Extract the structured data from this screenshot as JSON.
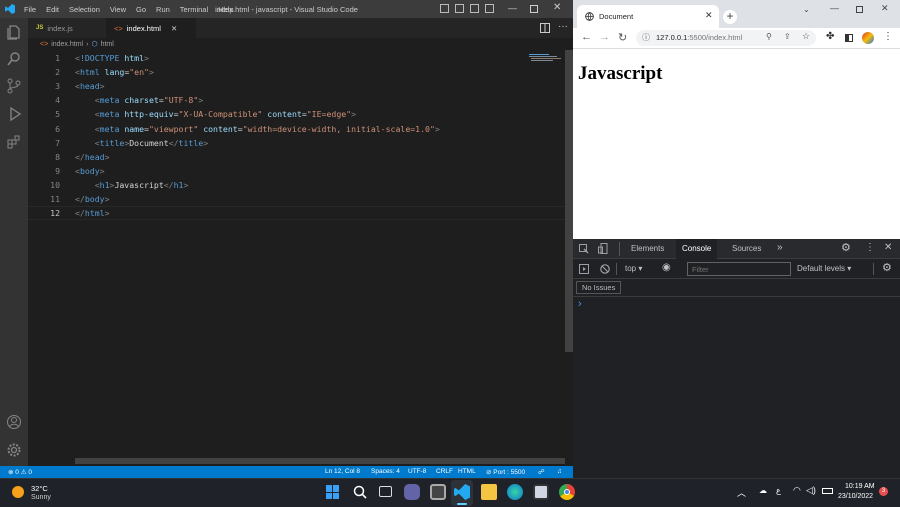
{
  "vscode": {
    "menu": [
      "File",
      "Edit",
      "Selection",
      "View",
      "Go",
      "Run",
      "Terminal",
      "Help"
    ],
    "window_title": "index.html - javascript - Visual Studio Code",
    "tabs": [
      {
        "badge": "JS",
        "label": "index.js",
        "active": false
      },
      {
        "badge": "",
        "label": "index.html",
        "active": true
      }
    ],
    "breadcrumb": [
      "index.html",
      "html"
    ],
    "lines": [
      {
        "n": "1",
        "html": "<span class='br'>&lt;</span><span class='tg'>!DOCTYPE</span> <span class='at'>html</span><span class='br'>&gt;</span>"
      },
      {
        "n": "2",
        "html": "<span class='br'>&lt;</span><span class='tg'>html</span> <span class='at'>lang</span>=<span class='st'>\"en\"</span><span class='br'>&gt;</span>"
      },
      {
        "n": "3",
        "html": "<span class='br'>&lt;</span><span class='tg'>head</span><span class='br'>&gt;</span>"
      },
      {
        "n": "4",
        "html": "    <span class='br'>&lt;</span><span class='tg'>meta</span> <span class='at'>charset</span>=<span class='st'>\"UTF-8\"</span><span class='br'>&gt;</span>"
      },
      {
        "n": "5",
        "html": "    <span class='br'>&lt;</span><span class='tg'>meta</span> <span class='at'>http-equiv</span>=<span class='st'>\"X-UA-Compatible\"</span> <span class='at'>content</span>=<span class='st'>\"IE=edge\"</span><span class='br'>&gt;</span>"
      },
      {
        "n": "6",
        "html": "    <span class='br'>&lt;</span><span class='tg'>meta</span> <span class='at'>name</span>=<span class='st'>\"viewport\"</span> <span class='at'>content</span>=<span class='st'>\"width=device-width, initial-scale=1.0\"</span><span class='br'>&gt;</span>"
      },
      {
        "n": "7",
        "html": "    <span class='br'>&lt;</span><span class='tg'>title</span><span class='br'>&gt;</span>Document<span class='br'>&lt;/</span><span class='tg'>title</span><span class='br'>&gt;</span>"
      },
      {
        "n": "8",
        "html": "<span class='br'>&lt;/</span><span class='tg'>head</span><span class='br'>&gt;</span>"
      },
      {
        "n": "9",
        "html": "<span class='br'>&lt;</span><span class='tg'>body</span><span class='br'>&gt;</span>"
      },
      {
        "n": "10",
        "html": "    <span class='br'>&lt;</span><span class='tg'>h1</span><span class='br'>&gt;</span>Javascript<span class='br'>&lt;/</span><span class='tg'>h1</span><span class='br'>&gt;</span>"
      },
      {
        "n": "11",
        "html": "<span class='br'>&lt;/</span><span class='tg'>body</span><span class='br'>&gt;</span>"
      },
      {
        "n": "12",
        "html": "<span class='br'>&lt;/</span><span class='tg'>html</span><span class='br'>&gt;</span>"
      }
    ],
    "status": {
      "errors": "0",
      "warnings": "0",
      "position": "Ln 12, Col 8",
      "spaces": "Spaces: 4",
      "encoding": "UTF-8",
      "eol": "CRLF",
      "language": "HTML",
      "port": "Port : 5500"
    }
  },
  "chrome": {
    "tab_title": "Document",
    "url_host": "127.0.0.1",
    "url_rest": ":5500/index.html",
    "heading": "Javascript",
    "devtools": {
      "tabs": [
        "Elements",
        "Console",
        "Sources"
      ],
      "context": "top",
      "filter_placeholder": "Filter",
      "levels": "Default levels",
      "issues": "No Issues",
      "prompt": "›"
    }
  },
  "taskbar": {
    "weather_temp": "32°C",
    "weather_cond": "Sunny",
    "time": "10:19 AM",
    "date": "23/10/2022",
    "notif_count": "3",
    "lang": "ع"
  },
  "colors": {
    "vscode_blue": "#007acc",
    "titlebar": "#3c3c3c",
    "devtools_bg": "#202124"
  }
}
